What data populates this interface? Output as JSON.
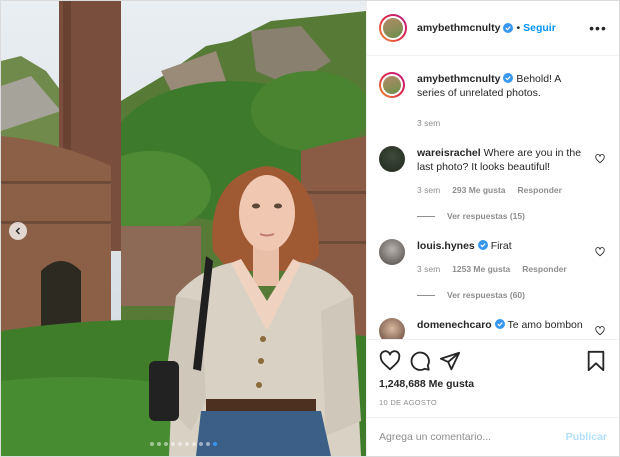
{
  "post": {
    "author": "amybethmcnulty",
    "follow_label": "Seguir",
    "separator": "•",
    "more_label": "•••",
    "caption": "Behold! A series of unrelated photos.",
    "caption_time": "3 sem"
  },
  "comments": [
    {
      "user": "wareisrachel",
      "text": "Where are you in the last photo? It looks beautiful!",
      "verified": false,
      "time": "3 sem",
      "likes": "293 Me gusta",
      "reply": "Responder",
      "view_replies": "Ver respuestas (15)"
    },
    {
      "user": "louis.hynes",
      "text": "Firat",
      "verified": true,
      "time": "3 sem",
      "likes": "1253 Me gusta",
      "reply": "Responder",
      "view_replies": "Ver respuestas (60)"
    },
    {
      "user": "domenechcaro",
      "text": "Te amo bombon",
      "verified": true
    }
  ],
  "actions": {
    "likes": "1,248,688 Me gusta",
    "date": "10 DE AGOSTO"
  },
  "composer": {
    "placeholder": "Agrega un comentario...",
    "publish_label": "Publicar"
  },
  "icons": {
    "like": "heart-icon",
    "comment": "comment-icon",
    "share": "share-icon",
    "save": "bookmark-icon",
    "verified": "verified-badge-icon",
    "prev": "chevron-left-icon"
  },
  "colors": {
    "link_blue": "#0095f6",
    "verified_blue": "#3897f0",
    "muted_gray": "#8e8e8e",
    "publish_disabled": "#b2dffc"
  },
  "carousel": {
    "slide_count": 10,
    "current_slide": 10
  }
}
